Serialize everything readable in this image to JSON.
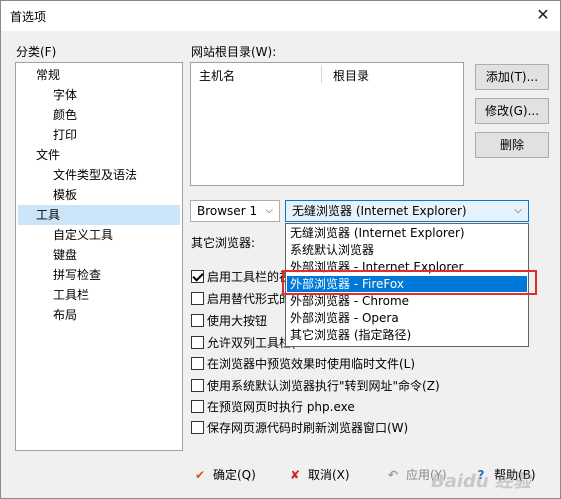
{
  "window": {
    "title": "首选项",
    "close_glyph": "✕"
  },
  "category": {
    "label": "分类(F)",
    "items": [
      {
        "label": "常规"
      },
      {
        "label": "字体"
      },
      {
        "label": "颜色"
      },
      {
        "label": "打印"
      },
      {
        "label": "文件"
      },
      {
        "label": "文件类型及语法"
      },
      {
        "label": "模板"
      },
      {
        "label": "工具"
      },
      {
        "label": "自定义工具"
      },
      {
        "label": "键盘"
      },
      {
        "label": "拼写检查"
      },
      {
        "label": "工具栏"
      },
      {
        "label": "布局"
      }
    ]
  },
  "site_root": {
    "label": "网站根目录(W):",
    "columns": [
      "主机名",
      "根目录"
    ],
    "buttons": {
      "add": "添加(T)...",
      "edit": "修改(G)...",
      "delete": "删除"
    }
  },
  "browser": {
    "selector_value": "Browser 1",
    "type_value": "无缝浏览器 (Internet Explorer)",
    "other_label": "其它浏览器:",
    "options": [
      "无缝浏览器 (Internet Explorer)",
      "系统默认浏览器",
      "外部浏览器 - Internet Explorer",
      "外部浏览器 - FireFox",
      "外部浏览器 - Chrome",
      "外部浏览器 - Opera",
      "其它浏览器 (指定路径)"
    ],
    "highlighted_index": 3
  },
  "checkboxes": [
    {
      "label": "启用工具栏的视",
      "checked": true
    },
    {
      "label": "启用替代形式的",
      "checked": false
    },
    {
      "label": "使用大按钮",
      "checked": false
    },
    {
      "label": "允许双列工具栏(",
      "checked": false
    },
    {
      "label": "在浏览器中预览效果时使用临时文件(L)",
      "checked": false
    },
    {
      "label": "使用系统默认浏览器执行\"转到网址\"命令(Z)",
      "checked": false
    },
    {
      "label": "在预览网页时执行 php.exe",
      "checked": false
    },
    {
      "label": "保存网页源代码时刷新浏览器窗口(W)",
      "checked": false
    }
  ],
  "footer": {
    "ok": "确定(Q)",
    "cancel": "取消(X)",
    "apply": "应用(Y)",
    "help": "帮助(B)"
  },
  "watermark": "Baidu 经验",
  "colors": {
    "accent": "#0078d7",
    "highlight_box": "#e22b2b",
    "tree_selected": "#cce4f7"
  }
}
